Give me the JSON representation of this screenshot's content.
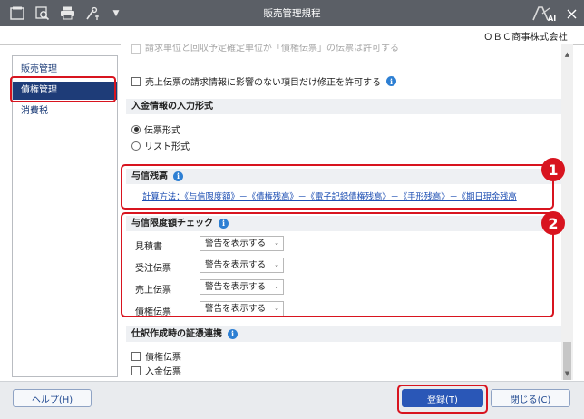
{
  "window": {
    "title": "販売管理規程",
    "company": "ＯＢＣ商事株式会社",
    "toolbar_icons": [
      "home-icon",
      "search-icon",
      "print-icon",
      "settings-icon",
      "menu-down-icon"
    ],
    "logo_text": "AI"
  },
  "nav": {
    "items": [
      {
        "label": "販売管理",
        "active": false
      },
      {
        "label": "債権管理",
        "active": true
      },
      {
        "label": "消費税",
        "active": false
      }
    ]
  },
  "main": {
    "faded_top": "請求単位と回収予定確定単位が「債権伝票」の伝票は許可する",
    "option_allow_modify": "売上伝票の請求情報に影響のない項目だけ修正を許可する",
    "section_payment_input": {
      "title": "入金情報の入力形式",
      "options": [
        {
          "label": "伝票形式",
          "selected": true
        },
        {
          "label": "リスト形式",
          "selected": false
        }
      ]
    },
    "section_credit_balance": {
      "title": "与信残高",
      "formula_link": "計算方法：《与信限度額》－《債権残高》－《電子記録債権残高》－《手形残高》－《期日現金残高"
    },
    "section_credit_check": {
      "title": "与信限度額チェック",
      "rows": [
        {
          "label": "見積書",
          "value": "警告を表示する"
        },
        {
          "label": "受注伝票",
          "value": "警告を表示する"
        },
        {
          "label": "売上伝票",
          "value": "警告を表示する"
        },
        {
          "label": "債権伝票",
          "value": "警告を表示する"
        }
      ]
    },
    "section_journal": {
      "title": "仕訳作成時の証憑連携",
      "checks": [
        {
          "label": "債権伝票",
          "checked": false
        },
        {
          "label": "入金伝票",
          "checked": false
        }
      ]
    }
  },
  "callouts": {
    "badge1": "1",
    "badge2": "2"
  },
  "footer": {
    "help": "ヘルプ(H)",
    "register": "登録(T)",
    "close": "閉じる(C)"
  },
  "colors": {
    "titlebar": "#5b5f66",
    "nav_active": "#1e3c78",
    "highlight": "#d8141f",
    "info": "#2d7fd3",
    "primary_button": "#2a57b7"
  }
}
